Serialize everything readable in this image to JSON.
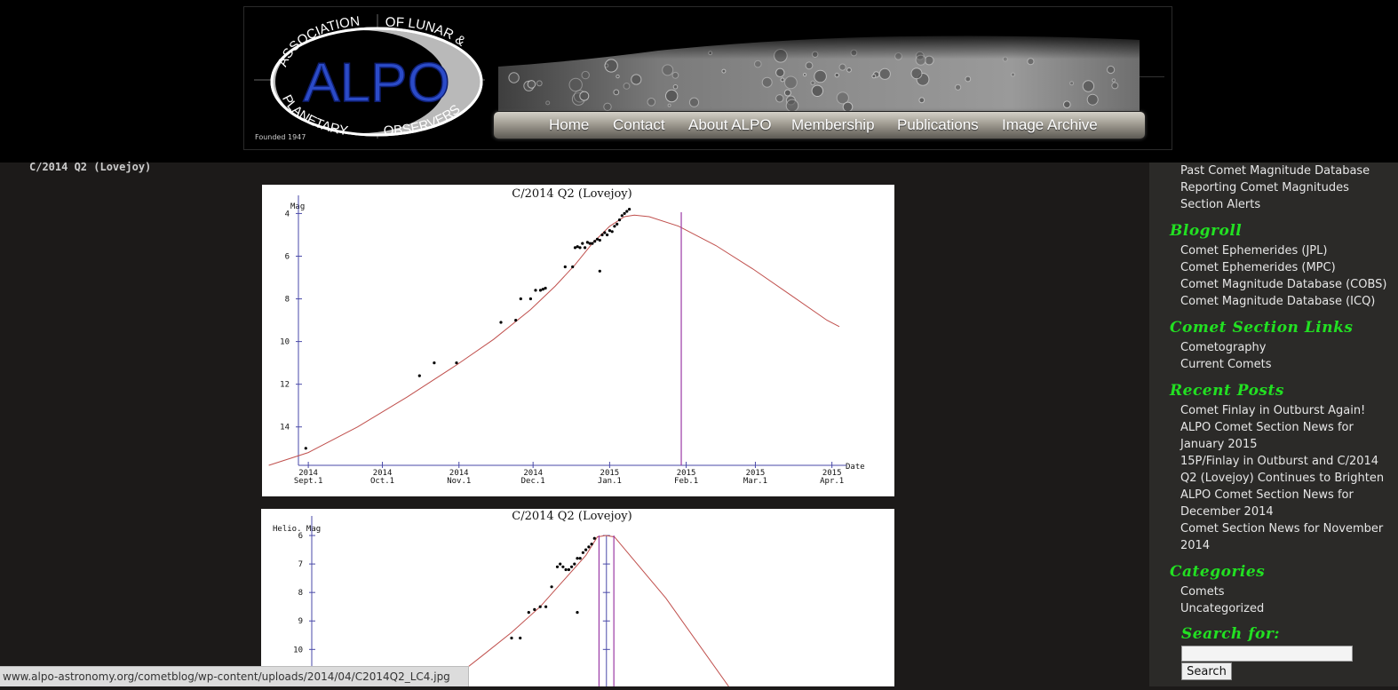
{
  "header": {
    "logo": {
      "top_text": "ASSOCIATION",
      "arc_right_text": "OF LUNAR &",
      "bottom_left_text": "PLANETARY",
      "bottom_right_text": "OBSERVERS",
      "acronym": "ALPO",
      "founded": "Founded 1947"
    },
    "nav": [
      {
        "label": "Home"
      },
      {
        "label": "Contact"
      },
      {
        "label": "About ALPO"
      },
      {
        "label": "Membership"
      },
      {
        "label": "Publications"
      },
      {
        "label": "Image Archive"
      }
    ]
  },
  "page": {
    "heading": "C/2014 Q2 (Lovejoy)"
  },
  "sidebar": {
    "top_links": [
      "Past Comet Magnitude Database",
      "Reporting Comet Magnitudes",
      "Section Alerts"
    ],
    "sections": [
      {
        "title": "Blogroll",
        "links": [
          "Comet Ephemerides (JPL)",
          "Comet Ephemerides (MPC)",
          "Comet Magnitude Database (COBS)",
          "Comet Magnitude Database (ICQ)"
        ]
      },
      {
        "title": "Comet Section Links",
        "links": [
          "Cometography",
          "Current Comets"
        ]
      },
      {
        "title": "Recent Posts",
        "links": [
          "Comet Finlay in Outburst Again!",
          "ALPO Comet Section News for January 2015",
          "15P/Finlay in Outburst and C/2014 Q2 (Lovejoy) Continues to Brighten",
          "ALPO Comet Section News for December 2014",
          "Comet Section News for November 2014"
        ]
      },
      {
        "title": "Categories",
        "links": [
          "Comets",
          "Uncategorized"
        ]
      }
    ],
    "search": {
      "label": "Search for:",
      "button": "Search",
      "value": ""
    }
  },
  "status_url": "www.alpo-astronomy.org/cometblog/wp-content/uploads/2014/04/C2014Q2_LC4.jpg",
  "colors": {
    "accent_green": "#22e022",
    "curve": "#c0504d",
    "marker_line": "#9b3aa6",
    "axis": "#4a4aa8"
  },
  "chart_data": [
    {
      "type": "scatter",
      "title": "C/2014 Q2 (Lovejoy)",
      "ylabel": "Mag",
      "xlabel": "Date",
      "y_inverted": true,
      "ylim": [
        15.8,
        3.4
      ],
      "xlim": [
        -4,
        215
      ],
      "x_ticks": [
        {
          "x": 0,
          "year": "2014",
          "month": "Sept.1"
        },
        {
          "x": 30,
          "year": "2014",
          "month": "Oct.1"
        },
        {
          "x": 61,
          "year": "2014",
          "month": "Nov.1"
        },
        {
          "x": 91,
          "year": "2014",
          "month": "Dec.1"
        },
        {
          "x": 122,
          "year": "2015",
          "month": "Jan.1"
        },
        {
          "x": 153,
          "year": "2015",
          "month": "Feb.1"
        },
        {
          "x": 181,
          "year": "2015",
          "month": "Mar.1"
        },
        {
          "x": 212,
          "year": "2015",
          "month": "Apr.1"
        }
      ],
      "y_ticks": [
        4,
        6,
        8,
        10,
        12,
        14
      ],
      "marker_x": 151,
      "curve": [
        [
          -16,
          15.8
        ],
        [
          0,
          15.2
        ],
        [
          20,
          14.0
        ],
        [
          40,
          12.6
        ],
        [
          60,
          11.1
        ],
        [
          75,
          9.9
        ],
        [
          90,
          8.5
        ],
        [
          100,
          7.4
        ],
        [
          108,
          6.4
        ],
        [
          115,
          5.4
        ],
        [
          122,
          4.6
        ],
        [
          128,
          4.15
        ],
        [
          132,
          4.08
        ],
        [
          138,
          4.15
        ],
        [
          150,
          4.6
        ],
        [
          165,
          5.5
        ],
        [
          180,
          6.6
        ],
        [
          195,
          7.8
        ],
        [
          210,
          9.0
        ],
        [
          215,
          9.3
        ]
      ],
      "points": [
        [
          -1,
          15.0
        ],
        [
          45,
          11.6
        ],
        [
          51,
          11.0
        ],
        [
          60,
          11.0
        ],
        [
          78,
          9.1
        ],
        [
          84,
          9.0
        ],
        [
          86,
          8.0
        ],
        [
          90,
          8.0
        ],
        [
          92,
          7.6
        ],
        [
          94,
          7.6
        ],
        [
          95,
          7.55
        ],
        [
          96,
          7.5
        ],
        [
          104,
          6.5
        ],
        [
          107,
          6.5
        ],
        [
          108,
          5.6
        ],
        [
          109,
          5.55
        ],
        [
          110,
          5.6
        ],
        [
          111,
          5.4
        ],
        [
          112,
          5.6
        ],
        [
          113,
          5.35
        ],
        [
          114,
          5.4
        ],
        [
          115,
          5.4
        ],
        [
          116,
          5.3
        ],
        [
          117,
          5.2
        ],
        [
          118,
          5.25
        ],
        [
          118,
          6.7
        ],
        [
          119,
          5.0
        ],
        [
          120,
          4.9
        ],
        [
          121,
          5.0
        ],
        [
          122,
          4.8
        ],
        [
          123,
          4.85
        ],
        [
          124,
          4.6
        ],
        [
          125,
          4.5
        ],
        [
          126,
          4.3
        ],
        [
          127,
          4.1
        ],
        [
          128,
          4.0
        ],
        [
          129,
          3.9
        ],
        [
          130,
          3.8
        ]
      ]
    },
    {
      "type": "scatter",
      "title": "C/2014 Q2 (Lovejoy)",
      "ylabel": "Helio. Mag",
      "y_inverted": true,
      "ylim": [
        11.3,
        5.5
      ],
      "xlim": [
        0,
        100
      ],
      "y_ticks": [
        6,
        7,
        8,
        9,
        10
      ],
      "marker_x": [
        50.3,
        52.9
      ],
      "curve": [
        [
          23,
          11.3
        ],
        [
          30,
          10.2
        ],
        [
          35,
          9.4
        ],
        [
          40,
          8.5
        ],
        [
          44,
          7.6
        ],
        [
          48,
          6.7
        ],
        [
          50,
          6.05
        ],
        [
          51.5,
          6.0
        ],
        [
          53,
          6.05
        ],
        [
          62,
          8.2
        ],
        [
          73,
          11.3
        ]
      ],
      "points": [
        [
          35,
          9.6
        ],
        [
          36.5,
          9.6
        ],
        [
          38,
          8.7
        ],
        [
          39,
          8.6
        ],
        [
          40,
          8.5
        ],
        [
          41,
          8.5
        ],
        [
          42,
          7.8
        ],
        [
          43,
          7.1
        ],
        [
          43.5,
          7.0
        ],
        [
          44,
          7.1
        ],
        [
          44.5,
          7.2
        ],
        [
          45,
          7.2
        ],
        [
          45.5,
          7.1
        ],
        [
          46,
          7.0
        ],
        [
          46.5,
          6.8
        ],
        [
          46.5,
          8.7
        ],
        [
          47,
          6.8
        ],
        [
          47.5,
          6.6
        ],
        [
          48,
          6.5
        ],
        [
          48.5,
          6.4
        ],
        [
          49,
          6.3
        ],
        [
          49.5,
          6.1
        ]
      ]
    }
  ]
}
